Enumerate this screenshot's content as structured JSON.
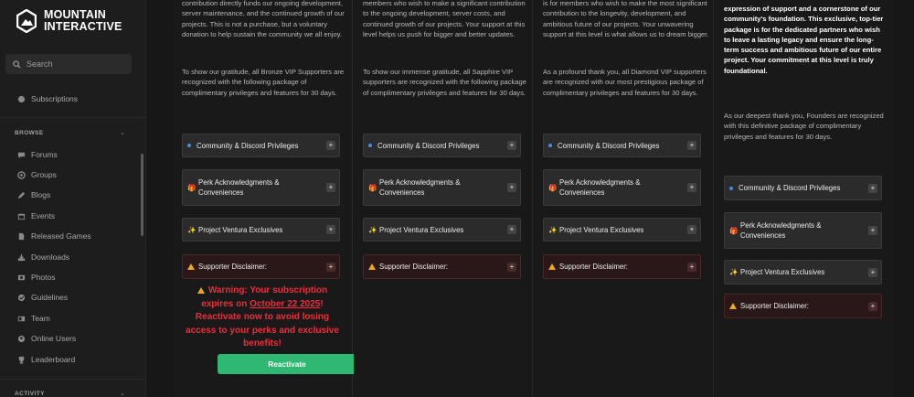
{
  "brand": {
    "line1": "MOUNTAIN",
    "line2": "INTERACTIVE"
  },
  "search": {
    "placeholder": "Search"
  },
  "sidebar": {
    "subscriptions": "Subscriptions",
    "browse_label": "BROWSE",
    "items": [
      "Forums",
      "Groups",
      "Blogs",
      "Events",
      "Released Games",
      "Downloads",
      "Photos",
      "Guidelines",
      "Team",
      "Online Users",
      "Leaderboard"
    ],
    "activity_label": "ACTIVITY"
  },
  "tiers": [
    {
      "intro": "contribution directly funds our ongoing development, server maintenance, and the continued growth of our projects. This is not a purchase, but a voluntary donation to help sustain the community we all enjoy.",
      "gratitude": "To show our gratitude, all Bronze VIP Supporters are recognized with the following package of complimentary privileges and features for 30 days."
    },
    {
      "intro": "members who wish to make a significant contribution to the ongoing development, server costs, and continued growth of our projects. Your support at this level helps us push for bigger and better updates.",
      "gratitude": "To show our immense gratitude, all Sapphire VIP supporters are recognized with the following package of complimentary privileges and features for 30 days."
    },
    {
      "intro": "is for members who wish to make the most significant contribution to the longevity, development, and ambitious future of our projects. Your unwavering support at this level is what allows us to dream bigger.",
      "gratitude": "As a profound thank you, all Diamond VIP supporters are recognized with our most prestigious package of complimentary privileges and features for 30 days."
    },
    {
      "intro": "expression of support and a cornerstone of our community's foundation. This exclusive, top-tier package is for the dedicated partners who wish to leave a lasting legacy and ensure the long-term success and ambitious future of our entire project. Your commitment at this level is truly foundational.",
      "gratitude": "As our deepest thank you, Founders are recognized with this definitive package of complimentary privileges and features for 30 days."
    }
  ],
  "accordion": {
    "community": "Community & Discord Privileges",
    "perk": "Perk Acknowledgments & Conveniences",
    "ventura": "Project Ventura Exclusives",
    "disclaimer": "Supporter Disclaimer:",
    "expand": "+"
  },
  "warning": {
    "prefix": "Warning: Your subscription expires on ",
    "date": "October 22 2025",
    "suffix": "! Reactivate now to avoid losing access to your perks and exclusive benefits!"
  },
  "reactivate_label": "Reactivate",
  "colors": {
    "accent_green": "#2eb872",
    "warning_red": "#ec2d3b",
    "bullet_blue": "#4a8de0"
  }
}
